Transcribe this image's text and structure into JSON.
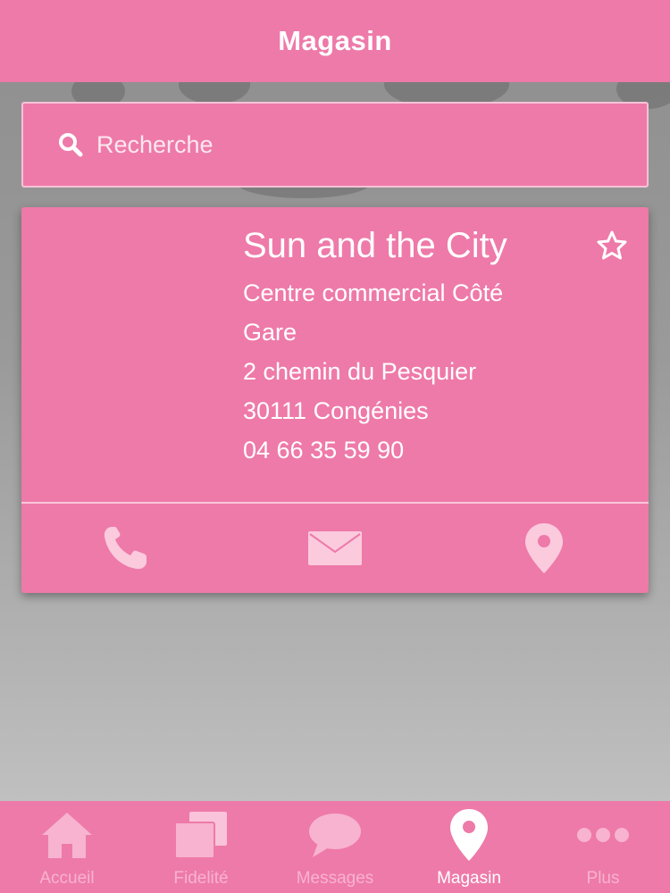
{
  "header": {
    "title": "Magasin"
  },
  "search": {
    "placeholder": "Recherche"
  },
  "store": {
    "name": "Sun and the City",
    "address_line1": "Centre commercial Côté",
    "address_line2": "Gare",
    "street": "2 chemin du Pesquier",
    "city": "30111 Congénies",
    "phone": "04 66 35 59 90"
  },
  "tabs": [
    {
      "label": "Accueil",
      "icon": "home-icon",
      "active": false
    },
    {
      "label": "Fidelité",
      "icon": "cards-icon",
      "active": false
    },
    {
      "label": "Messages",
      "icon": "chat-icon",
      "active": false
    },
    {
      "label": "Magasin",
      "icon": "map-pin-icon",
      "active": true
    },
    {
      "label": "Plus",
      "icon": "more-icon",
      "active": false
    }
  ],
  "colors": {
    "accent": "#ee7aa9",
    "tab_inactive": "#f7b3cf",
    "text": "#ffffff"
  }
}
